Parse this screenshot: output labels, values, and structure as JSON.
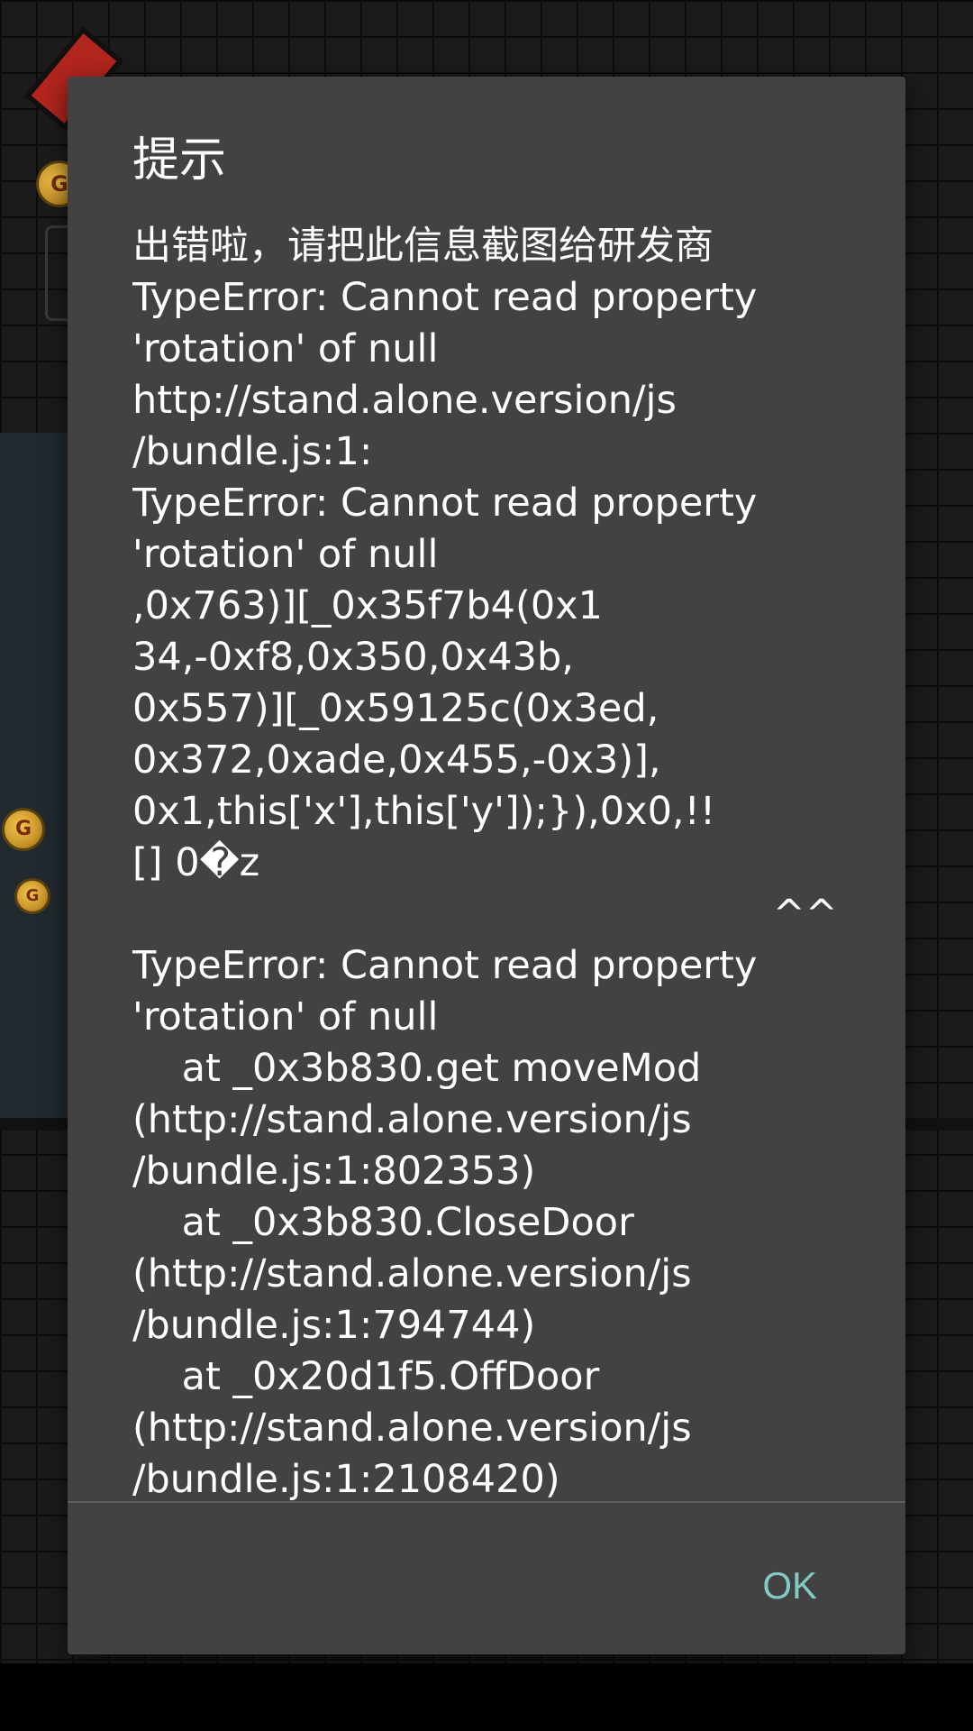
{
  "dialog": {
    "title": "提示",
    "message_lines": [
      "出错啦，请把此信息截图给研发商",
      "TypeError: Cannot read property",
      "'rotation' of null",
      "http://stand.alone.version/js",
      "/bundle.js:1:",
      "TypeError: Cannot read property",
      "'rotation' of null",
      ",0x763)][_0x35f7b4(0x1",
      "34,-0xf8,0x350,0x43b,",
      "0x557)][_0x59125c(0x3ed,",
      "0x372,0xade,0x455,-0x3)],",
      "0x1,this['x'],this['y']);}),0x0,!!",
      "[] 0�z",
      "                                                    ^^",
      "TypeError: Cannot read property",
      "'rotation' of null",
      "    at _0x3b830.get moveMod",
      "(http://stand.alone.version/js",
      "/bundle.js:1:802353)",
      "    at _0x3b830.CloseDoor",
      "(http://stand.alone.version/js",
      "/bundle.js:1:794744)",
      "    at _0x20d1f5.OffDoor",
      "(http://stand.alone.version/js",
      "/bundle.js:1:2108420)"
    ],
    "ok_label": "OK"
  },
  "background": {
    "coin_label": "G"
  },
  "colors": {
    "dialog_bg": "#424242",
    "text": "#ffffff",
    "accent": "#80cbc4",
    "divider": "#5c5c5c",
    "backdrop": "#000000"
  }
}
